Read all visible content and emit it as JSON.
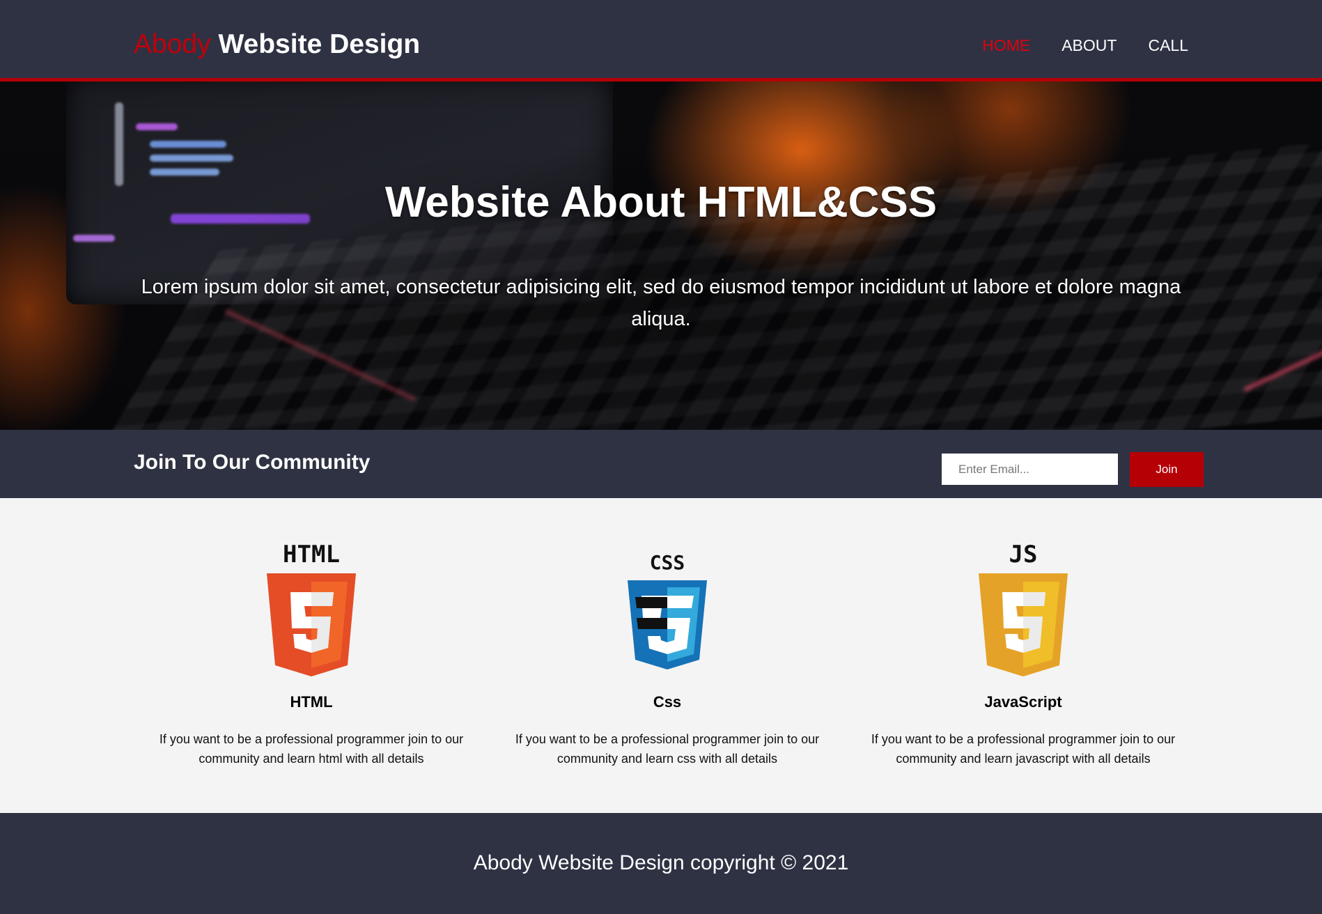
{
  "header": {
    "logo_accent": "Abody",
    "logo_main": "Website Design",
    "nav": [
      {
        "label": "Home",
        "active": true
      },
      {
        "label": "About",
        "active": false
      },
      {
        "label": "Call",
        "active": false
      }
    ]
  },
  "hero": {
    "title": "Website About HTML&CSS",
    "text": "Lorem ipsum dolor sit amet, consectetur adipisicing elit, sed do eiusmod tempor incididunt ut labore et dolore magna aliqua."
  },
  "community": {
    "title": "Join To Our Community",
    "email_placeholder": "Enter Email...",
    "join_label": "Join"
  },
  "features": [
    {
      "logo_text": "HTML",
      "title": "HTML",
      "text": "If you want to be a professional programmer join to our community and learn html with all details"
    },
    {
      "logo_text": "CSS",
      "title": "Css",
      "text": "If you want to be a professional programmer join to our community and learn css with all details"
    },
    {
      "logo_text": "JS",
      "title": "JavaScript",
      "text": "If you want to be a professional programmer join to our community and learn javascript with all details"
    }
  ],
  "footer": {
    "text": "Abody Website Design copyright © 2021"
  },
  "colors": {
    "header_bg": "#2f3243",
    "accent_red": "#b50006",
    "nav_active": "#e0000b",
    "page_bg": "#f4f4f4"
  }
}
